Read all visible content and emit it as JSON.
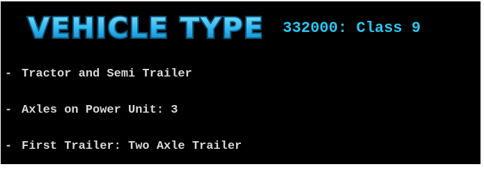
{
  "header": {
    "title": "VEHICLE TYPE",
    "class_label": "332000: Class 9",
    "colors": {
      "title_fill": "#2ab3ee",
      "title_glow": "#0a4f73",
      "class_label": "#29c6ef",
      "background": "#000000",
      "text": "#d9d9d9"
    }
  },
  "attributes": [
    {
      "text": "Tractor and Semi Trailer"
    },
    {
      "text": "Axles on Power Unit: 3"
    },
    {
      "text": "First Trailer: Two Axle Trailer"
    }
  ]
}
